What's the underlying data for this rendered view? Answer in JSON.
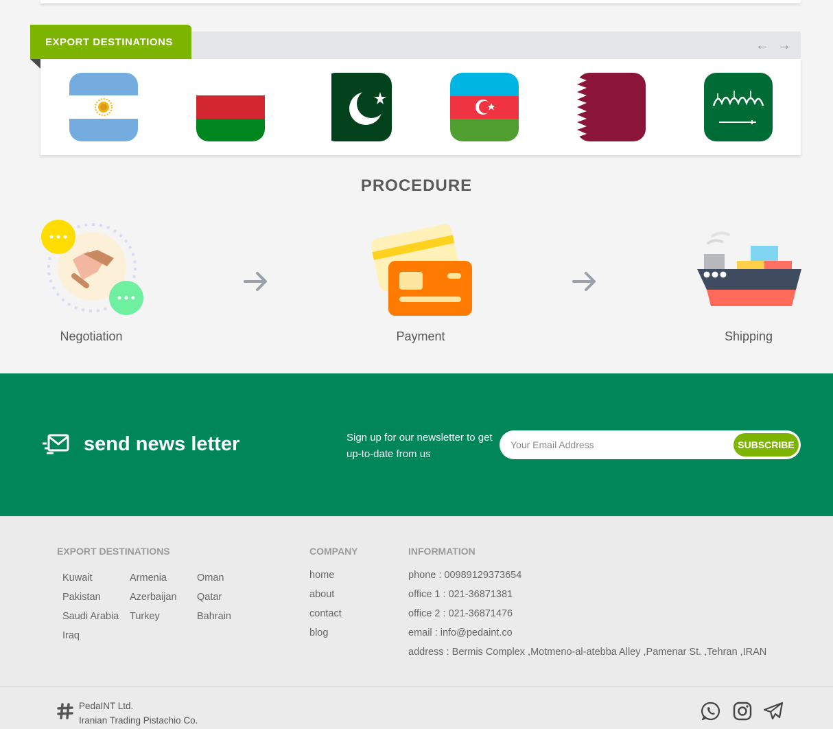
{
  "export_section": {
    "tab_label": "EXPORT DESTINATIONS",
    "prev_arrow": "←",
    "next_arrow": "→",
    "flag_icons": [
      "argentina-flag-icon",
      "belarus-flag-icon",
      "pakistan-flag-icon",
      "azerbaijan-flag-icon",
      "qatar-flag-icon",
      "saudi-arabia-flag-icon"
    ]
  },
  "procedure": {
    "title": "PROCEDURE",
    "steps": [
      {
        "label": "Negotiation",
        "icon": "handshake-icon"
      },
      {
        "label": "Payment",
        "icon": "payment-card-icon"
      },
      {
        "label": "Shipping",
        "icon": "cargo-ship-icon"
      }
    ],
    "arrow_glyph": "→"
  },
  "newsletter": {
    "title": "send news letter",
    "description": "Sign up for our newsletter to get up-to-date from us",
    "placeholder": "Your Email Address",
    "button": "SUBSCRIBE"
  },
  "footer": {
    "export_heading": "EXPORT DESTINATIONS",
    "countries": [
      "Kuwait",
      "Armenia",
      "Oman",
      "Pakistan",
      "Azerbaijan",
      "Qatar",
      "Saudi Arabia",
      "Turkey",
      "Bahrain",
      "Iraq"
    ],
    "company_heading": "COMPANY",
    "company_links": [
      "home",
      "about",
      "contact",
      "blog"
    ],
    "info_heading": "INFORMATION",
    "info": [
      "phone : 00989129373654",
      "office 1 : 021-36871381",
      "office 2 : 021-36871476",
      "email : info@pedaint.co",
      "address : Bermis Complex ,Motmeno-al-atebba Alley ,Pamenar St. ,Tehran ,IRAN"
    ]
  },
  "bottom_bar": {
    "company_name": "PedaINT Ltd.",
    "tagline": "Iranian Trading Pistachio Co.",
    "social_icons": [
      "whatsapp-icon",
      "instagram-icon",
      "telegram-icon"
    ]
  },
  "colors": {
    "accent_green": "#7db400",
    "newsletter_bg": "#008659",
    "footer_bg": "#ebebeb"
  }
}
